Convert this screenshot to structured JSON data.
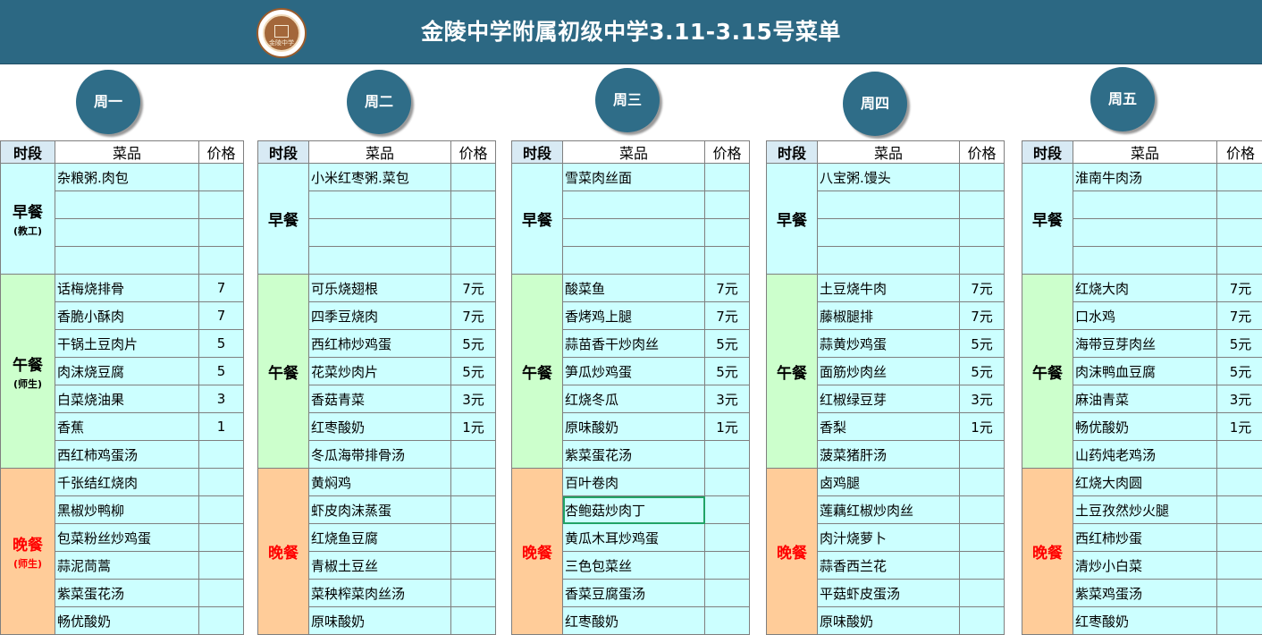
{
  "title": "金陵中学附属初级中学3.11-3.15号菜单",
  "logo": {
    "text": "金陵中学"
  },
  "headers": {
    "segment": "时段",
    "dish": "菜品",
    "price": "价格"
  },
  "meals": {
    "breakfast": "早餐",
    "lunch": "午餐",
    "dinner": "晚餐"
  },
  "days": [
    {
      "name": "周一",
      "breakfast_note": "(教工)",
      "lunch_note": "(师生)",
      "dinner_note": "(师生)",
      "breakfast": [
        {
          "dish": "杂粮粥.肉包",
          "price": ""
        },
        {
          "dish": "",
          "price": ""
        },
        {
          "dish": "",
          "price": ""
        },
        {
          "dish": "",
          "price": ""
        }
      ],
      "lunch": [
        {
          "dish": "话梅烧排骨",
          "price": "7"
        },
        {
          "dish": "香脆小酥肉",
          "price": "7"
        },
        {
          "dish": "干锅土豆肉片",
          "price": "5"
        },
        {
          "dish": "肉沫烧豆腐",
          "price": "5"
        },
        {
          "dish": "白菜烧油果",
          "price": "3"
        },
        {
          "dish": "香蕉",
          "price": "1"
        },
        {
          "dish": "西红柿鸡蛋汤",
          "price": ""
        }
      ],
      "dinner": [
        {
          "dish": "千张结红烧肉",
          "price": ""
        },
        {
          "dish": "黑椒炒鸭柳",
          "price": ""
        },
        {
          "dish": "包菜粉丝炒鸡蛋",
          "price": ""
        },
        {
          "dish": "蒜泥茼蒿",
          "price": ""
        },
        {
          "dish": "紫菜蛋花汤",
          "price": ""
        },
        {
          "dish": "畅优酸奶",
          "price": ""
        }
      ]
    },
    {
      "name": "周二",
      "breakfast_note": "",
      "lunch_note": "",
      "dinner_note": "",
      "breakfast": [
        {
          "dish": "小米红枣粥.菜包",
          "price": ""
        },
        {
          "dish": "",
          "price": ""
        },
        {
          "dish": "",
          "price": ""
        },
        {
          "dish": "",
          "price": ""
        }
      ],
      "lunch": [
        {
          "dish": "可乐烧翅根",
          "price": "7元"
        },
        {
          "dish": "四季豆烧肉",
          "price": "7元"
        },
        {
          "dish": "西红柿炒鸡蛋",
          "price": "5元"
        },
        {
          "dish": "花菜炒肉片",
          "price": "5元"
        },
        {
          "dish": "香菇青菜",
          "price": "3元"
        },
        {
          "dish": "红枣酸奶",
          "price": "1元"
        },
        {
          "dish": "冬瓜海带排骨汤",
          "price": ""
        }
      ],
      "dinner": [
        {
          "dish": "黄焖鸡",
          "price": ""
        },
        {
          "dish": "虾皮肉沫蒸蛋",
          "price": ""
        },
        {
          "dish": "红烧鱼豆腐",
          "price": ""
        },
        {
          "dish": "青椒土豆丝",
          "price": ""
        },
        {
          "dish": "菜秧榨菜肉丝汤",
          "price": ""
        },
        {
          "dish": "原味酸奶",
          "price": ""
        }
      ]
    },
    {
      "name": "周三",
      "breakfast_note": "",
      "lunch_note": "",
      "dinner_note": "",
      "breakfast": [
        {
          "dish": "雪菜肉丝面",
          "price": ""
        },
        {
          "dish": "",
          "price": ""
        },
        {
          "dish": "",
          "price": ""
        },
        {
          "dish": "",
          "price": ""
        }
      ],
      "lunch": [
        {
          "dish": "酸菜鱼",
          "price": "7元"
        },
        {
          "dish": "香烤鸡上腿",
          "price": "7元"
        },
        {
          "dish": "蒜苗香干炒肉丝",
          "price": "5元"
        },
        {
          "dish": "笋瓜炒鸡蛋",
          "price": "5元"
        },
        {
          "dish": "红烧冬瓜",
          "price": "3元"
        },
        {
          "dish": "原味酸奶",
          "price": "1元"
        },
        {
          "dish": "紫菜蛋花汤",
          "price": ""
        }
      ],
      "dinner": [
        {
          "dish": "百叶卷肉",
          "price": ""
        },
        {
          "dish": "杏鲍菇炒肉丁",
          "price": ""
        },
        {
          "dish": "黄瓜木耳炒鸡蛋",
          "price": ""
        },
        {
          "dish": "三色包菜丝",
          "price": ""
        },
        {
          "dish": "香菜豆腐蛋汤",
          "price": ""
        },
        {
          "dish": "红枣酸奶",
          "price": ""
        }
      ]
    },
    {
      "name": "周四",
      "breakfast_note": "",
      "lunch_note": "",
      "dinner_note": "",
      "breakfast": [
        {
          "dish": "八宝粥.馒头",
          "price": ""
        },
        {
          "dish": "",
          "price": ""
        },
        {
          "dish": "",
          "price": ""
        },
        {
          "dish": "",
          "price": ""
        }
      ],
      "lunch": [
        {
          "dish": "土豆烧牛肉",
          "price": "7元"
        },
        {
          "dish": "藤椒腿排",
          "price": "7元"
        },
        {
          "dish": "蒜黄炒鸡蛋",
          "price": "5元"
        },
        {
          "dish": "面筋炒肉丝",
          "price": "5元"
        },
        {
          "dish": "红椒绿豆芽",
          "price": "3元"
        },
        {
          "dish": "香梨",
          "price": "1元"
        },
        {
          "dish": "菠菜猪肝汤",
          "price": ""
        }
      ],
      "dinner": [
        {
          "dish": "卤鸡腿",
          "price": ""
        },
        {
          "dish": "莲藕红椒炒肉丝",
          "price": ""
        },
        {
          "dish": "肉汁烧萝卜",
          "price": ""
        },
        {
          "dish": "蒜香西兰花",
          "price": ""
        },
        {
          "dish": "平菇虾皮蛋汤",
          "price": ""
        },
        {
          "dish": "原味酸奶",
          "price": ""
        }
      ]
    },
    {
      "name": "周五",
      "breakfast_note": "",
      "lunch_note": "",
      "dinner_note": "",
      "breakfast": [
        {
          "dish": "淮南牛肉汤",
          "price": ""
        },
        {
          "dish": "",
          "price": ""
        },
        {
          "dish": "",
          "price": ""
        },
        {
          "dish": "",
          "price": ""
        }
      ],
      "lunch": [
        {
          "dish": "红烧大肉",
          "price": "7元"
        },
        {
          "dish": "口水鸡",
          "price": "7元"
        },
        {
          "dish": "海带豆芽肉丝",
          "price": "5元"
        },
        {
          "dish": "肉沫鸭血豆腐",
          "price": "5元"
        },
        {
          "dish": "麻油青菜",
          "price": "3元"
        },
        {
          "dish": "畅优酸奶",
          "price": "1元"
        },
        {
          "dish": "山药炖老鸡汤",
          "price": ""
        }
      ],
      "dinner": [
        {
          "dish": "红烧大肉圆",
          "price": ""
        },
        {
          "dish": "土豆孜然炒火腿",
          "price": ""
        },
        {
          "dish": "西红柿炒蛋",
          "price": ""
        },
        {
          "dish": "清炒小白菜",
          "price": ""
        },
        {
          "dish": "紫菜鸡蛋汤",
          "price": ""
        },
        {
          "dish": "红枣酸奶",
          "price": ""
        }
      ]
    }
  ],
  "colors": {
    "header_bg": "#2c6883",
    "day_circle": "#2f6d88",
    "cell_cyan": "#ccffff",
    "lunch_green": "#ccffcc",
    "dinner_orange": "#ffcc99",
    "dinner_text": "#ff0000",
    "selection": "#21a366"
  }
}
